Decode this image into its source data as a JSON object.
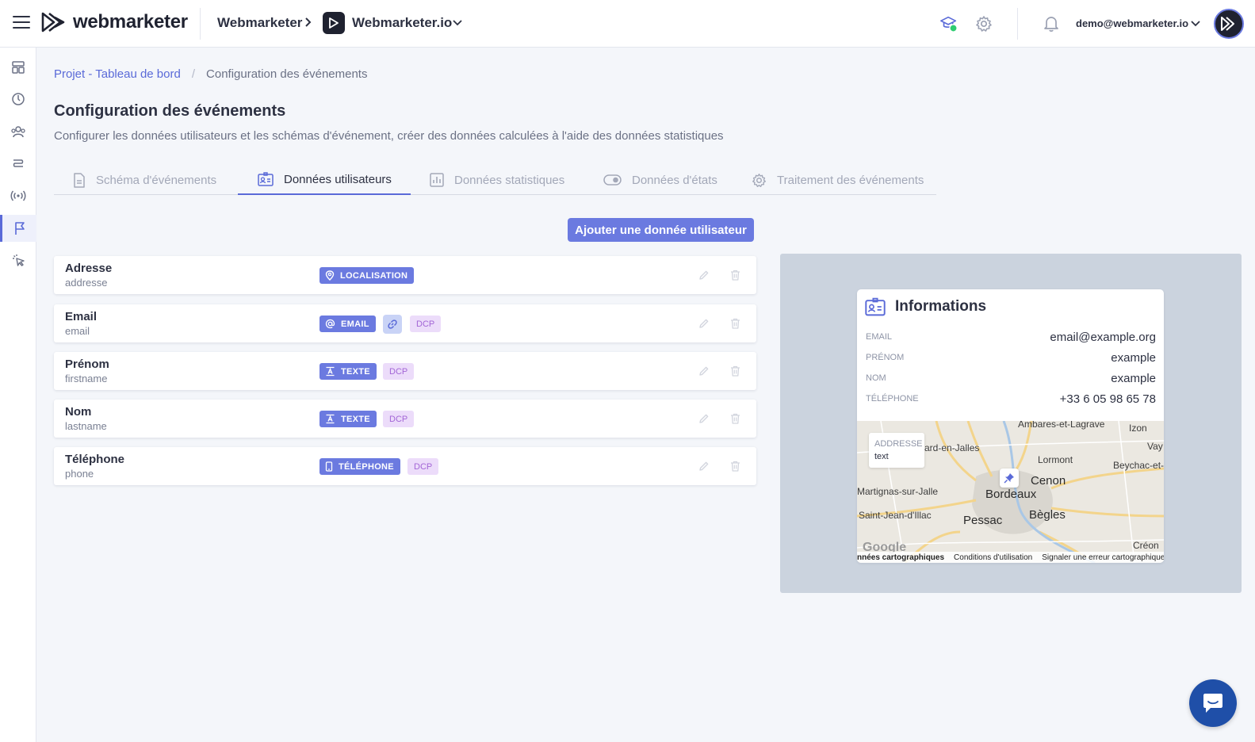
{
  "header": {
    "brand": "webmarketer",
    "organization": "Webmarketer",
    "project": "Webmarketer.io",
    "user_email": "demo@webmarketer.io"
  },
  "sidebar": {
    "items": [
      {
        "icon": "dashboard-icon"
      },
      {
        "icon": "gauge-icon"
      },
      {
        "icon": "users-icon"
      },
      {
        "icon": "routes-icon"
      },
      {
        "icon": "broadcast-icon"
      },
      {
        "icon": "flag-icon",
        "active": true
      },
      {
        "icon": "pointer-click-icon"
      }
    ]
  },
  "breadcrumb": {
    "parent": "Projet - Tableau de bord",
    "current": "Configuration des événements"
  },
  "page": {
    "title": "Configuration des événements",
    "description": "Configurer les données utilisateurs et les schémas d'événement, créer des données calculées à l'aide des données statistiques"
  },
  "tabs": [
    {
      "label": "Schéma d'événements",
      "active": false
    },
    {
      "label": "Données utilisateurs",
      "active": true
    },
    {
      "label": "Données statistiques",
      "active": false
    },
    {
      "label": "Données d'états",
      "active": false
    },
    {
      "label": "Traitement des événements",
      "active": false
    }
  ],
  "actions": {
    "add_label": "Ajouter une donnée utilisateur"
  },
  "user_data": [
    {
      "name": "Adresse",
      "key": "addresse",
      "type": "LOCALISATION",
      "linked": false,
      "dcp": null
    },
    {
      "name": "Email",
      "key": "email",
      "type": "EMAIL",
      "linked": true,
      "dcp": "DCP"
    },
    {
      "name": "Prénom",
      "key": "firstname",
      "type": "TEXTE",
      "linked": false,
      "dcp": "DCP"
    },
    {
      "name": "Nom",
      "key": "lastname",
      "type": "TEXTE",
      "linked": false,
      "dcp": "DCP"
    },
    {
      "name": "Téléphone",
      "key": "phone",
      "type": "TÉLÉPHONE",
      "linked": false,
      "dcp": "DCP"
    }
  ],
  "preview": {
    "title": "Informations",
    "fields": [
      {
        "label": "EMAIL",
        "value": "email@example.org"
      },
      {
        "label": "PRÉNOM",
        "value": "example"
      },
      {
        "label": "NOM",
        "value": "example"
      },
      {
        "label": "TÉLÉPHONE",
        "value": "+33 6 05 98 65 78"
      }
    ],
    "map": {
      "popup_label": "ADDRESSE",
      "popup_value": "text",
      "places": [
        {
          "name": "Ambares-et-Lagrave"
        },
        {
          "name": "Izon"
        },
        {
          "name": "ard-en-Jalles"
        },
        {
          "name": "Vay"
        },
        {
          "name": "Lormont"
        },
        {
          "name": "Beychac-et-Cailla"
        },
        {
          "name": "Cenon"
        },
        {
          "name": "Martignas-sur-Jalle"
        },
        {
          "name": "Bordeaux"
        },
        {
          "name": "Saint-Jean-d'Illac"
        },
        {
          "name": "Bègles"
        },
        {
          "name": "Pessac"
        },
        {
          "name": "Créon"
        }
      ],
      "footer": [
        "nnées cartographiques",
        "Conditions d'utilisation",
        "Signaler une erreur cartographique"
      ],
      "provider": "Google"
    }
  },
  "colors": {
    "accent": "#6b7ae0",
    "dcp_bg": "#ecdcfa",
    "dcp_text": "#a366d6"
  }
}
